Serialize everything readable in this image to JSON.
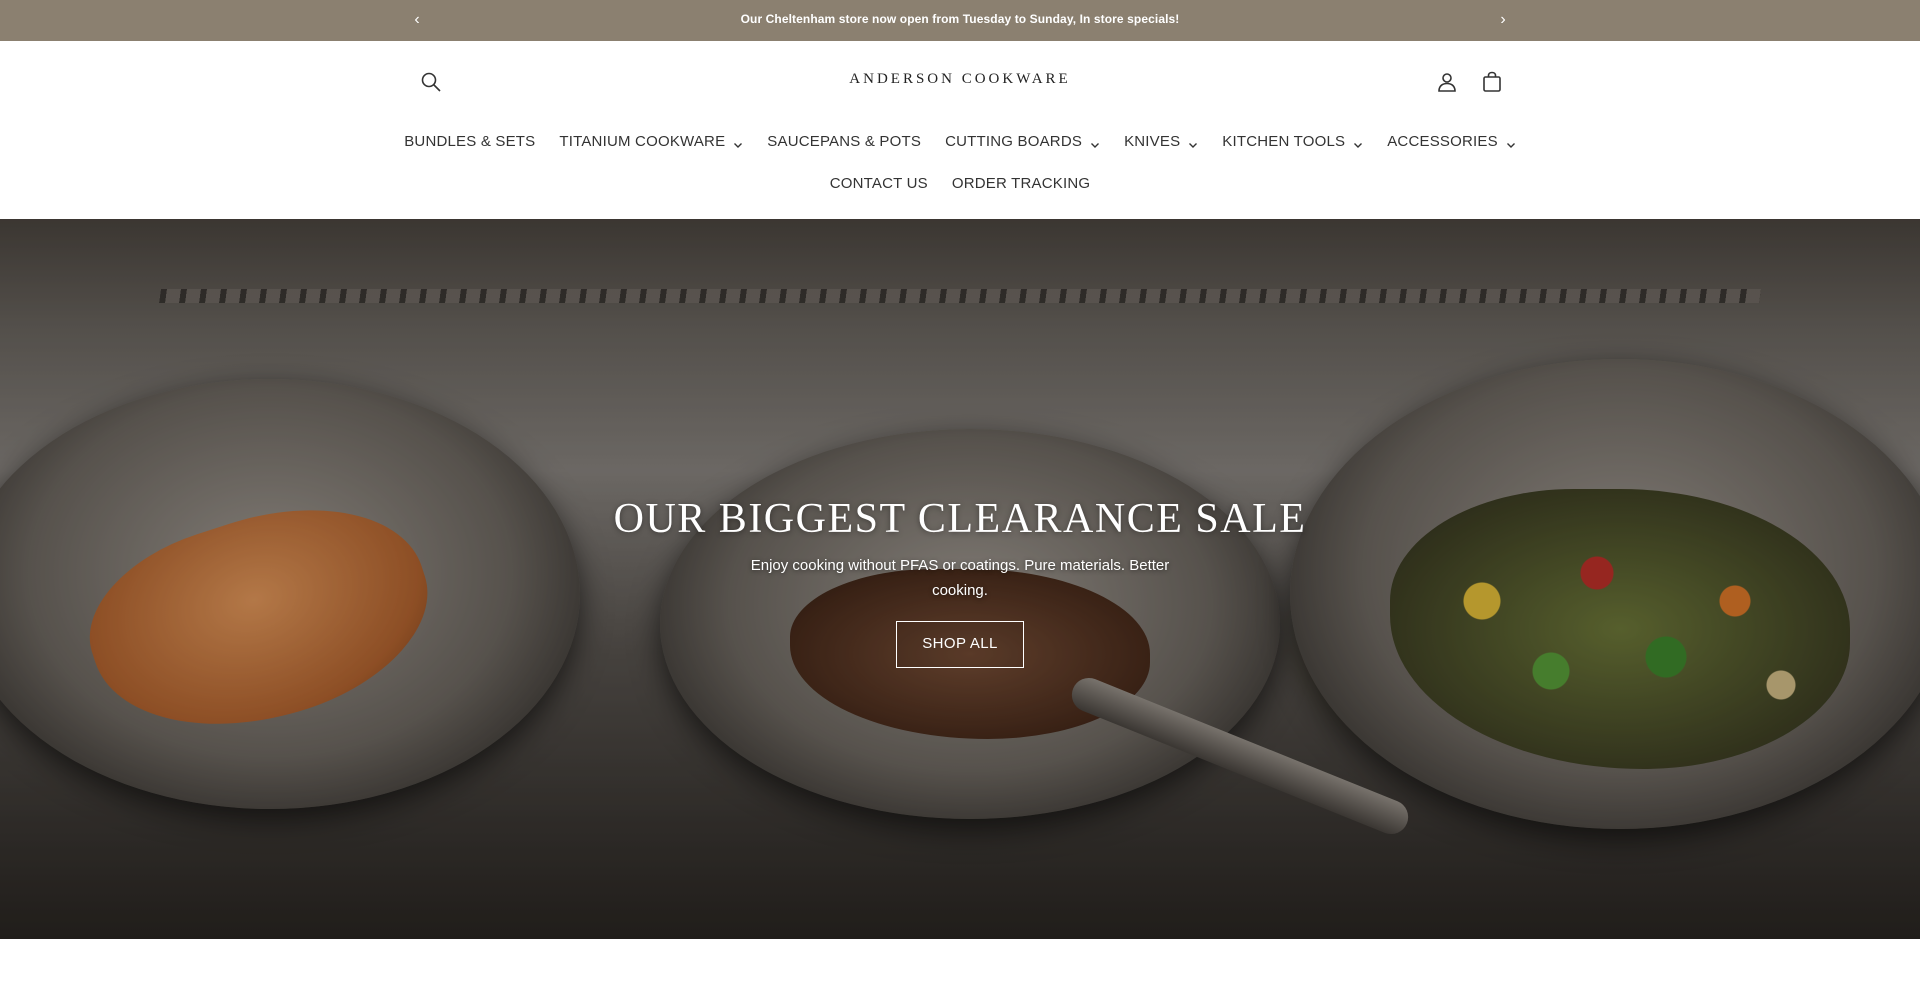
{
  "announcement": {
    "message": "Our Cheltenham store now open from Tuesday to Sunday, In store specials!",
    "prev_icon": "chevron-left-icon",
    "next_icon": "chevron-right-icon",
    "background": "#8b8070"
  },
  "header": {
    "logo": "ANDERSON COOKWARE",
    "search_icon": "search-icon",
    "account_icon": "account-icon",
    "cart_icon": "cart-icon"
  },
  "nav": {
    "row1": [
      {
        "label": "BUNDLES & SETS",
        "dropdown": false
      },
      {
        "label": "TITANIUM COOKWARE",
        "dropdown": true
      },
      {
        "label": "SAUCEPANS & POTS",
        "dropdown": false
      },
      {
        "label": "CUTTING BOARDS",
        "dropdown": true
      },
      {
        "label": "KNIVES",
        "dropdown": true
      },
      {
        "label": "KITCHEN TOOLS",
        "dropdown": true
      },
      {
        "label": "ACCESSORIES",
        "dropdown": true
      }
    ],
    "row2": [
      {
        "label": "CONTACT US",
        "dropdown": false
      },
      {
        "label": "ORDER TRACKING",
        "dropdown": false
      }
    ]
  },
  "hero": {
    "title": "OUR BIGGEST CLEARANCE SALE",
    "subtitle": "Enjoy cooking without PFAS or coatings. Pure materials. Better cooking.",
    "button": "SHOP ALL"
  }
}
